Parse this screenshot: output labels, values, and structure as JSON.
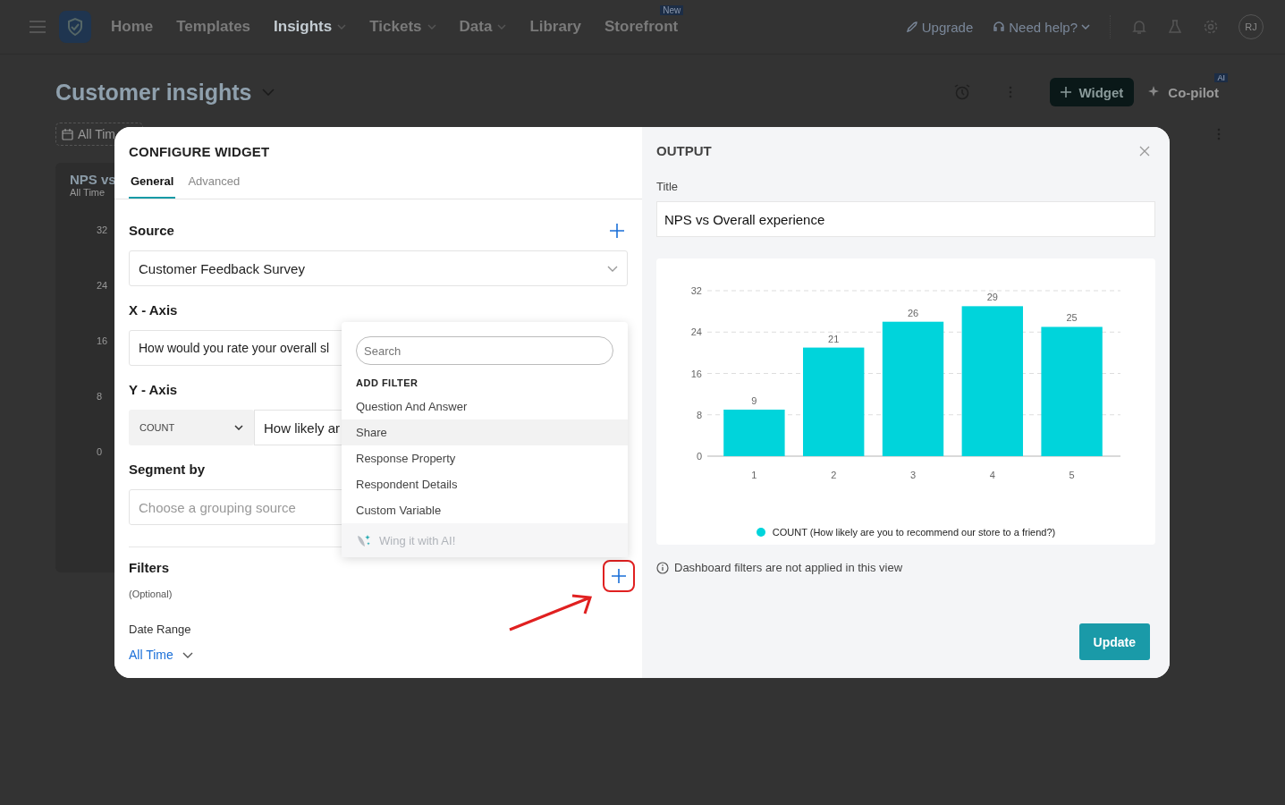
{
  "nav": {
    "items": [
      {
        "label": "Home",
        "selected": false,
        "has_menu": false
      },
      {
        "label": "Templates",
        "selected": false,
        "has_menu": false
      },
      {
        "label": "Insights",
        "selected": true,
        "has_menu": true
      },
      {
        "label": "Tickets",
        "selected": false,
        "has_menu": true
      },
      {
        "label": "Data",
        "selected": false,
        "has_menu": true
      },
      {
        "label": "Library",
        "selected": false,
        "has_menu": false
      },
      {
        "label": "Storefront",
        "selected": false,
        "has_menu": false,
        "badge": "New"
      }
    ],
    "upgrade": "Upgrade",
    "help": "Need help?",
    "avatar": "RJ"
  },
  "page": {
    "title": "Customer insights",
    "widget_button": "Widget",
    "copilot": "Co-pilot",
    "copilot_badge": "AI",
    "date_chip": "All Tim",
    "card": {
      "title": "NPS vs",
      "subtitle": "All Time",
      "ticks": [
        "32",
        "24",
        "16",
        "8",
        "0"
      ]
    }
  },
  "configure": {
    "title": "CONFIGURE WIDGET",
    "tabs": [
      {
        "label": "General",
        "selected": true
      },
      {
        "label": "Advanced",
        "selected": false
      }
    ],
    "source_label": "Source",
    "source_value": "Customer Feedback Survey",
    "x_axis_label": "X - Axis",
    "x_axis_value": "How would you rate your overall sl",
    "y_axis_label": "Y - Axis",
    "y_aggregate": "COUNT",
    "y_axis_value": "How likely ar",
    "segment_label": "Segment by",
    "segment_placeholder": "Choose a grouping source",
    "filters_label": "Filters",
    "filters_hint": "(Optional)",
    "date_range_label": "Date Range",
    "date_range_value": "All Time"
  },
  "filter_menu": {
    "search_placeholder": "Search",
    "heading": "ADD FILTER",
    "items": [
      {
        "label": "Question And Answer",
        "selected": false
      },
      {
        "label": "Share",
        "selected": true
      },
      {
        "label": "Response Property",
        "selected": false
      },
      {
        "label": "Respondent Details",
        "selected": false
      },
      {
        "label": "Custom Variable",
        "selected": false
      }
    ],
    "ai_option": "Wing it with AI!"
  },
  "output": {
    "title": "OUTPUT",
    "title_label": "Title",
    "title_value": "NPS vs Overall experience",
    "chart_data": {
      "type": "bar",
      "categories": [
        "1",
        "2",
        "3",
        "4",
        "5"
      ],
      "series": [
        {
          "name": "COUNT (How likely are you to recommend our store to a friend?)",
          "color": "#00d4db",
          "values": [
            9,
            21,
            26,
            29,
            25
          ]
        }
      ],
      "ylim": [
        0,
        32
      ],
      "yticks": [
        0,
        8,
        16,
        24,
        32
      ],
      "data_labels": true,
      "grid": true
    },
    "note": "Dashboard filters are not applied in this view",
    "update_button": "Update"
  }
}
